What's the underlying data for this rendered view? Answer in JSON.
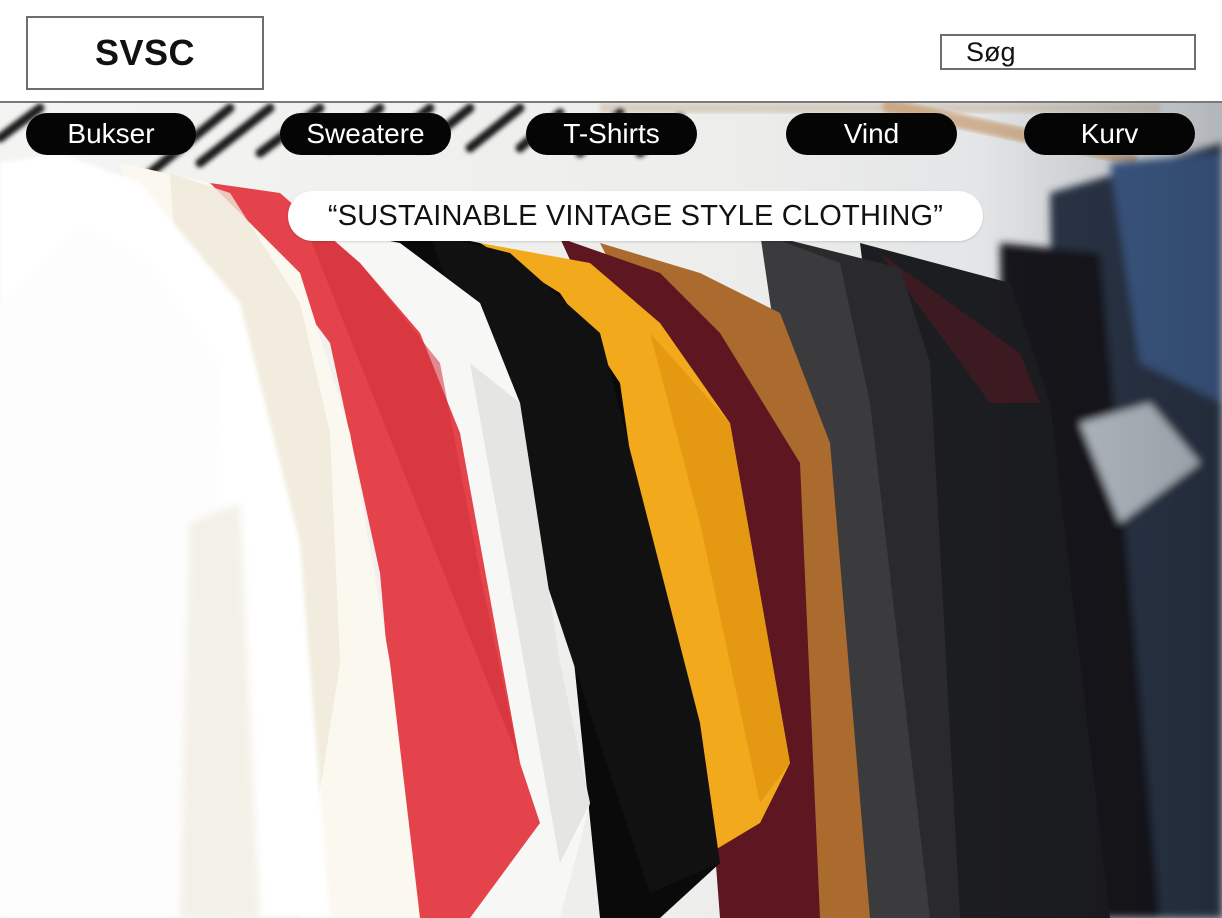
{
  "brand": {
    "logo": "SVSC"
  },
  "search": {
    "placeholder": "Søg",
    "value": ""
  },
  "nav": {
    "items": [
      {
        "id": "bukser",
        "label": "Bukser"
      },
      {
        "id": "sweatere",
        "label": "Sweatere"
      },
      {
        "id": "tshirts",
        "label": "T-Shirts"
      },
      {
        "id": "vind",
        "label": "Vind"
      },
      {
        "id": "kurv",
        "label": "Kurv"
      }
    ]
  },
  "hero": {
    "tagline": "“SUSTAINABLE VINTAGE STYLE CLOTHING”",
    "image": "clothing-rack-photo",
    "garment_colors": [
      "#ffffff",
      "#fbf8ef",
      "#e5434b",
      "#000000",
      "#f2a91b",
      "#651722",
      "#ad6b2f",
      "#2e2e30",
      "#1a1b1f",
      "#29344d"
    ]
  },
  "colors": {
    "nav_bg": "#050505",
    "nav_text": "#ffffff",
    "header_border": "#7a7a7a"
  }
}
